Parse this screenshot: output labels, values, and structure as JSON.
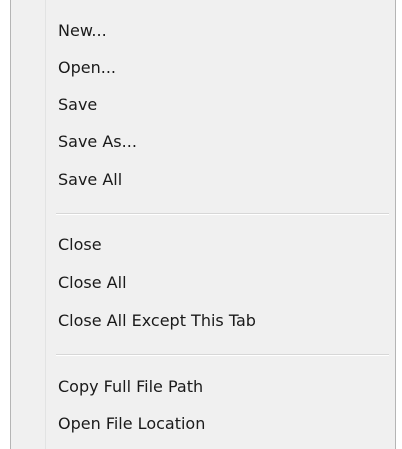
{
  "menu": {
    "group1": [
      "New...",
      "Open...",
      "Save",
      "Save As...",
      "Save All"
    ],
    "group2": [
      "Close",
      "Close All",
      "Close All Except This Tab"
    ],
    "group3": [
      "Copy Full File Path",
      "Open File Location"
    ]
  }
}
